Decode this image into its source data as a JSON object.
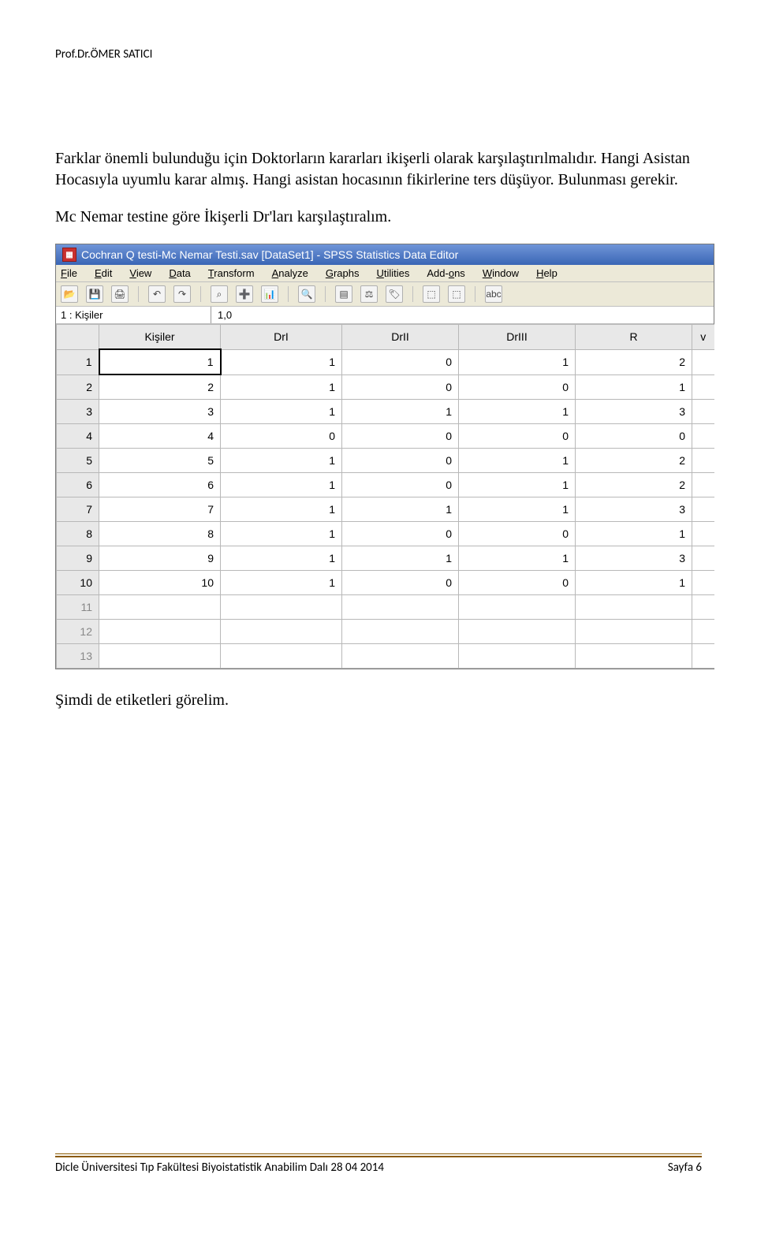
{
  "header": {
    "author": "Prof.Dr.ÖMER SATICI"
  },
  "paragraphs": {
    "p1": "Farklar önemli bulunduğu için Doktorların kararları ikişerli olarak karşılaştırılmalıdır. Hangi Asistan Hocasıyla uyumlu karar almış. Hangi asistan hocasının fikirlerine ters düşüyor. Bulunması gerekir.",
    "p2": "Mc Nemar testine göre İkişerli Dr'ları karşılaştıralım.",
    "p3": "Şimdi de etiketleri görelim."
  },
  "spss": {
    "title": "Cochran Q testi-Mc Nemar Testi.sav [DataSet1] - SPSS Statistics Data Editor",
    "menu": [
      "File",
      "Edit",
      "View",
      "Data",
      "Transform",
      "Analyze",
      "Graphs",
      "Utilities",
      "Add-ons",
      "Window",
      "Help"
    ],
    "cellIndicator": {
      "label": "1 : Kişiler",
      "value": "1,0"
    },
    "columns": [
      "Kişiler",
      "DrI",
      "DrII",
      "DrIII",
      "R"
    ],
    "partialCol": "v",
    "rows": [
      {
        "n": "1",
        "v": [
          "1",
          "1",
          "0",
          "1",
          "2"
        ]
      },
      {
        "n": "2",
        "v": [
          "2",
          "1",
          "0",
          "0",
          "1"
        ]
      },
      {
        "n": "3",
        "v": [
          "3",
          "1",
          "1",
          "1",
          "3"
        ]
      },
      {
        "n": "4",
        "v": [
          "4",
          "0",
          "0",
          "0",
          "0"
        ]
      },
      {
        "n": "5",
        "v": [
          "5",
          "1",
          "0",
          "1",
          "2"
        ]
      },
      {
        "n": "6",
        "v": [
          "6",
          "1",
          "0",
          "1",
          "2"
        ]
      },
      {
        "n": "7",
        "v": [
          "7",
          "1",
          "1",
          "1",
          "3"
        ]
      },
      {
        "n": "8",
        "v": [
          "8",
          "1",
          "0",
          "0",
          "1"
        ]
      },
      {
        "n": "9",
        "v": [
          "9",
          "1",
          "1",
          "1",
          "3"
        ]
      },
      {
        "n": "10",
        "v": [
          "10",
          "1",
          "0",
          "0",
          "1"
        ]
      }
    ],
    "emptyRows": [
      "11",
      "12",
      "13"
    ]
  },
  "footer": {
    "left": "Dicle Üniversitesi Tıp Fakültesi Biyoistatistik Anabilim Dalı 28 04 2014",
    "right": "Sayfa 6"
  },
  "icons": {
    "open": "📂",
    "save": "💾",
    "print": "🖨",
    "undo": "↶",
    "redo": "↷",
    "goto": "⌕",
    "insert": "➕",
    "chart": "📊",
    "find": "🔍",
    "cases": "▤",
    "weight": "⚖",
    "value": "🏷",
    "sets": "⬚",
    "spell": "abc"
  }
}
